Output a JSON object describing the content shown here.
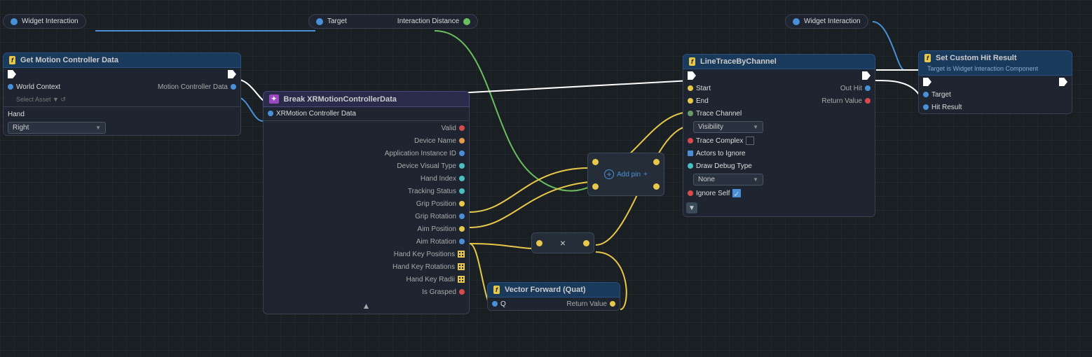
{
  "nodes": {
    "widget_interaction_1": {
      "label": "Widget Interaction",
      "pin_color": "blue"
    },
    "widget_interaction_2": {
      "label": "Widget Interaction",
      "pin_color": "blue"
    },
    "target_node": {
      "pin_left": "Target",
      "pin_right": "Interaction Distance"
    },
    "get_motion": {
      "title": "Get Motion Controller Data",
      "rows_left": [
        "World Context",
        "Hand"
      ],
      "rows_right": [
        "Motion Controller Data"
      ],
      "world_context_label": "World Context",
      "world_context_sub": "Select Asset",
      "hand_label": "Hand",
      "hand_value": "Right"
    },
    "break_xr": {
      "title": "Break XRMotionControllerData",
      "input_pin": "XRMotion Controller Data",
      "outputs": [
        "Valid",
        "Device Name",
        "Application Instance ID",
        "Device Visual Type",
        "Hand Index",
        "Tracking Status",
        "Grip Position",
        "Grip Rotation",
        "Aim Position",
        "Aim Rotation",
        "Hand Key Positions",
        "Hand Key Rotations",
        "Hand Key Radii",
        "Is Grasped"
      ]
    },
    "line_trace": {
      "title": "LineTraceByChannel",
      "inputs": [
        "Start",
        "End",
        "Trace Channel",
        "Trace Complex",
        "Actors to Ignore",
        "Draw Debug Type",
        "Ignore Self"
      ],
      "outputs": [
        "Out Hit",
        "Return Value"
      ],
      "trace_channel_value": "Visibility",
      "draw_debug_value": "None"
    },
    "set_custom": {
      "title": "Set Custom Hit Result",
      "subtitle": "Target is Widget Interaction Component",
      "inputs": [
        "Target",
        "Hit Result"
      ]
    },
    "vector_forward": {
      "title": "Vector Forward (Quat)",
      "input_pin": "Q",
      "output_pin": "Return Value"
    },
    "multiply_node": {
      "symbol": "×"
    },
    "add_pin": {
      "label": "Add pin",
      "plus": "+"
    }
  },
  "colors": {
    "blue": "#4a90d9",
    "yellow": "#e8c84a",
    "green": "#6abf5e",
    "red": "#d94a4a",
    "white": "#ffffff",
    "header_blue": "#1a3a5c",
    "header_purple": "#2a2a4a",
    "f_icon_bg": "#e8c84a"
  }
}
